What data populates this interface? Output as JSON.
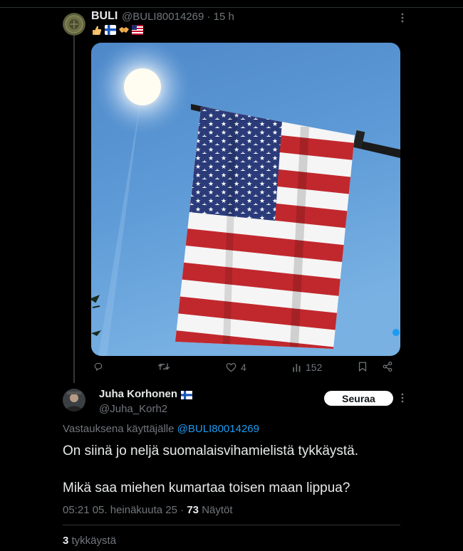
{
  "post": {
    "author_name": "BULI",
    "author_handle": "@BULI80014269",
    "time": "15 h",
    "separator": "·",
    "emoji_text": "👍🇫🇮🤝🇺🇸",
    "image_alt": "US flag hanging against a blue sky with the sun",
    "actions": {
      "likes": "4",
      "views": "152"
    }
  },
  "reply": {
    "author_name": "Juha Korhonen",
    "author_flag": "🇫🇮",
    "author_handle": "@Juha_Korh2",
    "follow_label": "Seuraa",
    "replying_prefix": "Vastauksena käyttäjälle",
    "replying_to": "@BULI80014269",
    "text_line1": "On siinä jo neljä suomalaisvihamielistä tykkäystä.",
    "text_line2": "Mikä saa miehen kumartaa toisen maan lippua?",
    "timestamp": "05:21 05. heinäkuuta 25",
    "dot": "·",
    "views_count": "73",
    "views_label": "Näytöt",
    "likes_count": "3",
    "likes_label": "tykkäystä"
  },
  "icons": [
    "more-icon",
    "reply-icon",
    "retweet-icon",
    "heart-icon",
    "views-icon",
    "bookmark-icon",
    "share-icon",
    "finnish-flag-icon"
  ],
  "colors": {
    "background": "#000000",
    "text": "#e7e9ea",
    "muted": "#71767b",
    "link": "#1d9bf0",
    "divider": "#2f3336"
  }
}
